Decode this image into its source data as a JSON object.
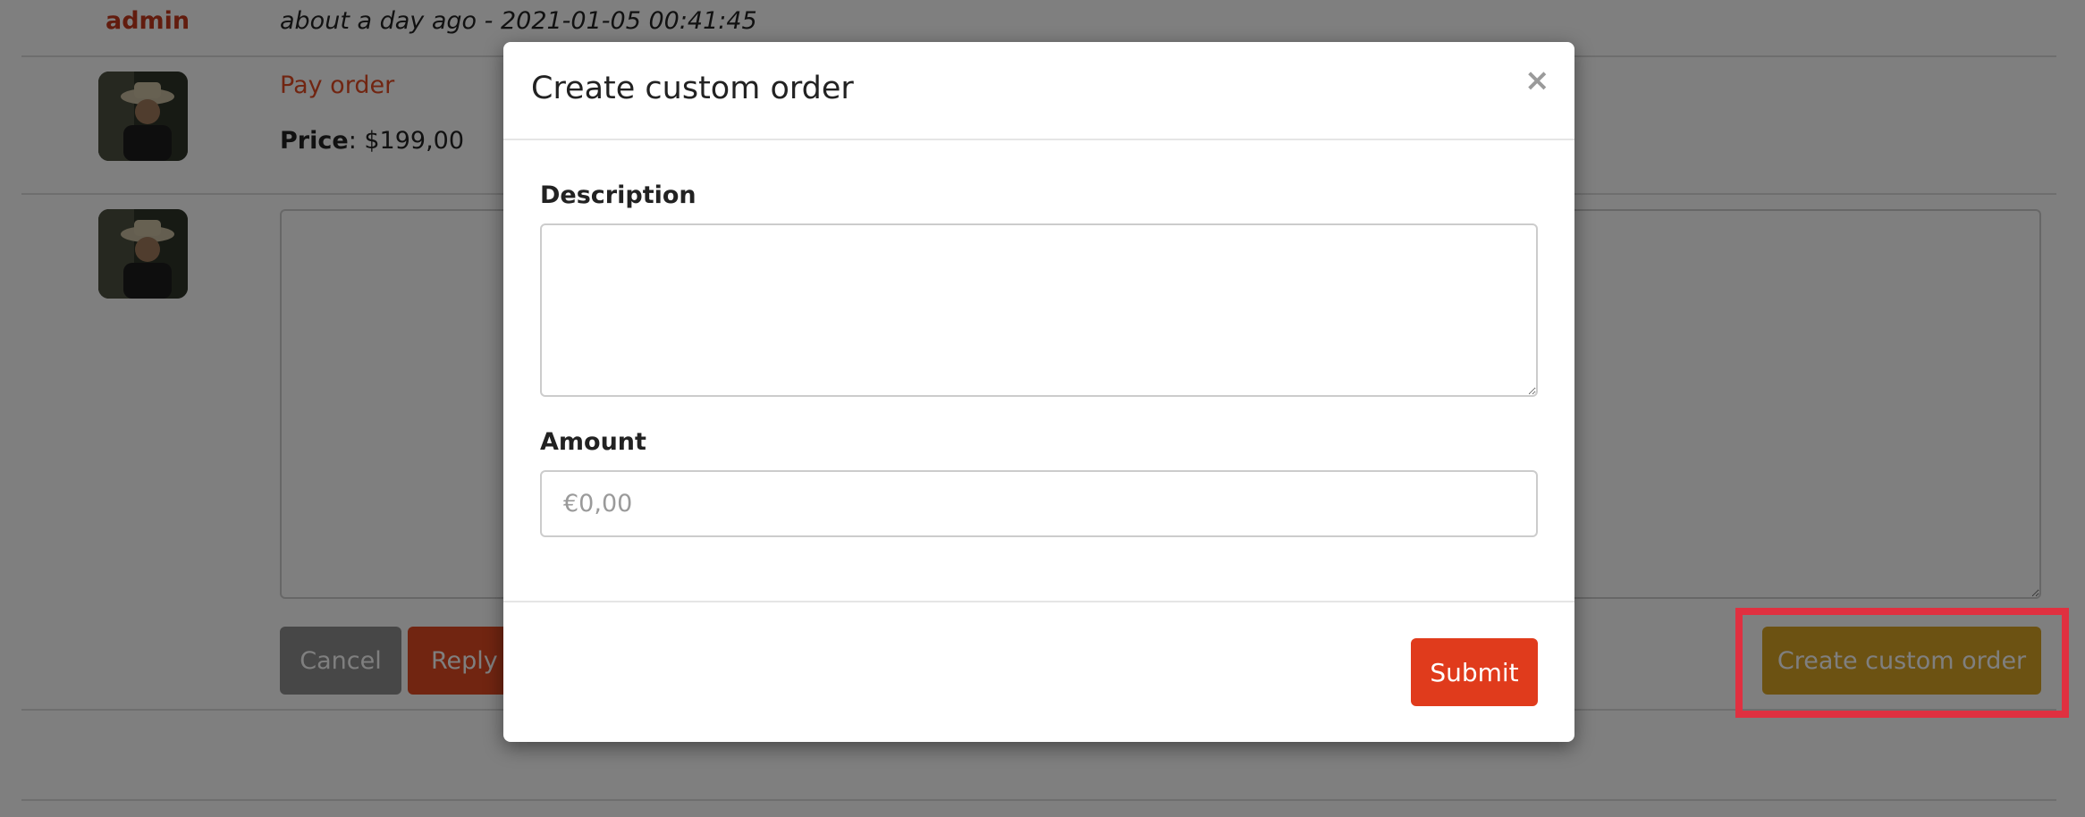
{
  "message": {
    "author": "admin",
    "meta": "about a day ago - 2021-01-05 00:41:45",
    "pay_link": "Pay order",
    "price_label": "Price",
    "price_value": ": $199,00"
  },
  "reply": {
    "cancel_label": "Cancel",
    "reply_label": "Reply",
    "custom_order_label": "Create custom order"
  },
  "modal": {
    "title": "Create custom order",
    "close_label": "×",
    "description_label": "Description",
    "amount_label": "Amount",
    "amount_placeholder": "€0,00",
    "submit_label": "Submit"
  },
  "colors": {
    "accent": "#e03b1c",
    "author": "#c4391d",
    "custom_order_button": "#d9a525",
    "cancel_button": "#8e8e8e",
    "highlight": "#e03040"
  },
  "icons": {
    "close": "close-icon",
    "avatar": "user-avatar"
  }
}
